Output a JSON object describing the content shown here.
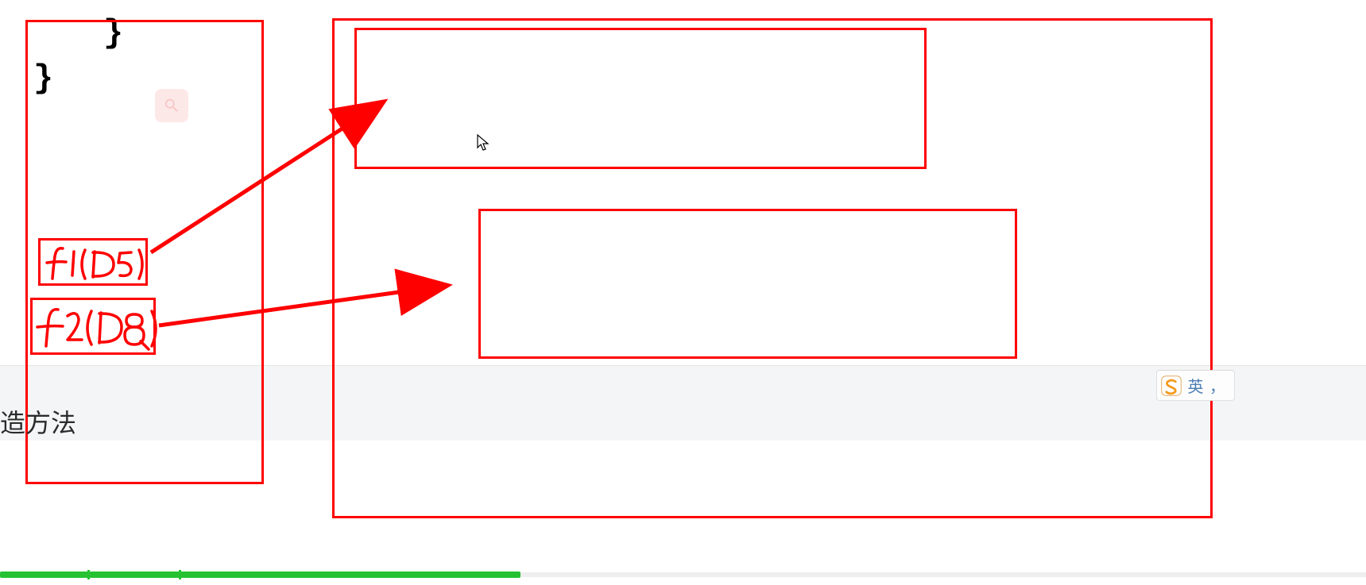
{
  "code": {
    "brace1": "}",
    "brace2": "}"
  },
  "icons": {
    "search": "search-icon"
  },
  "annotations": {
    "f1": "f1(D5)",
    "f2": "f2(D8)"
  },
  "footer": {
    "text": "造方法"
  },
  "ime": {
    "logo_letter": "S",
    "label": "英 ，"
  },
  "cursor": {
    "type": "arrow"
  },
  "colors": {
    "annotation_red": "#ff0000",
    "progress_green": "#26c232",
    "ime_blue": "#4a7db3",
    "ime_orange": "#f39a1e"
  }
}
